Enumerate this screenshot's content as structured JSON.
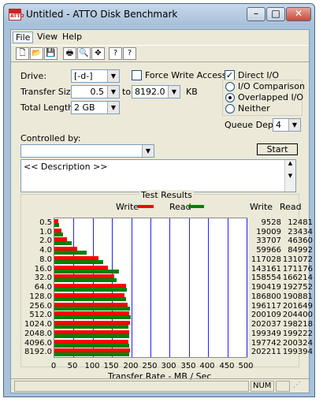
{
  "window": {
    "title": "Untitled - ATTO Disk Benchmark",
    "min": "–",
    "max": "□",
    "close": "✕",
    "app_icon_text": "ATTO"
  },
  "menu": {
    "file": "File",
    "view": "View",
    "help": "Help"
  },
  "toolbar": {
    "tools": [
      {
        "name": "new-file-icon",
        "glyph": "🗋"
      },
      {
        "name": "open-folder-icon",
        "glyph": "📂"
      },
      {
        "name": "save-icon",
        "glyph": "💾"
      },
      {
        "name": "print-icon",
        "glyph": "🖶"
      },
      {
        "name": "print-preview-icon",
        "glyph": "🔍"
      },
      {
        "name": "move-icon",
        "glyph": "✥"
      },
      {
        "name": "help-icon",
        "glyph": "?"
      },
      {
        "name": "context-help-icon",
        "glyph": "?"
      }
    ]
  },
  "form": {
    "drive_label": "Drive:",
    "drive_value": "[-d-]",
    "force_write_label": "Force Write Access",
    "force_write_checked": false,
    "transfer_size_label": "Transfer Size:",
    "transfer_from": "0.5",
    "to_label": "to",
    "transfer_to": "8192.0",
    "kb_label": "KB",
    "total_length_label": "Total Length:",
    "total_length": "2 GB",
    "direct_io_label": "Direct I/O",
    "direct_io_checked": true,
    "io_comparison_label": "I/O Comparison",
    "overlapped_io_label": "Overlapped I/O",
    "neither_label": "Neither",
    "selected_mode": "Overlapped I/O",
    "queue_depth_label": "Queue Depth:",
    "queue_depth": "4",
    "controlled_by_label": "Controlled by:",
    "controlled_by_value": "",
    "start_button": "Start",
    "description": "<< Description >>"
  },
  "results": {
    "title": "Test Results",
    "write_legend": "Write",
    "read_legend": "Read",
    "write_col": "Write",
    "read_col": "Read",
    "x_axis_label": "Transfer Rate - MB / Sec",
    "colors": {
      "write": "#ff0000",
      "read": "#008000",
      "grid": "#2020ff"
    }
  },
  "chart_data": {
    "type": "bar",
    "title": "Test Results",
    "xlabel": "Transfer Rate - MB / Sec",
    "xlim": [
      0,
      500
    ],
    "xticks": [
      0,
      50,
      100,
      150,
      200,
      250,
      300,
      350,
      400,
      450,
      500
    ],
    "categories": [
      "0.5",
      "1.0",
      "2.0",
      "4.0",
      "8.0",
      "16.0",
      "32.0",
      "64.0",
      "128.0",
      "256.0",
      "512.0",
      "1024.0",
      "2048.0",
      "4096.0",
      "8192.0"
    ],
    "series": [
      {
        "name": "Write",
        "values": [
          9528,
          19009,
          33707,
          59966,
          117028,
          143161,
          158554,
          190419,
          186800,
          196117,
          200109,
          202037,
          199349,
          197742,
          202211
        ]
      },
      {
        "name": "Read",
        "values": [
          12481,
          23434,
          46360,
          84992,
          131072,
          171176,
          166214,
          192752,
          190881,
          201649,
          204400,
          198218,
          199222,
          200324,
          199394
        ]
      }
    ]
  },
  "status": {
    "num": "NUM"
  }
}
